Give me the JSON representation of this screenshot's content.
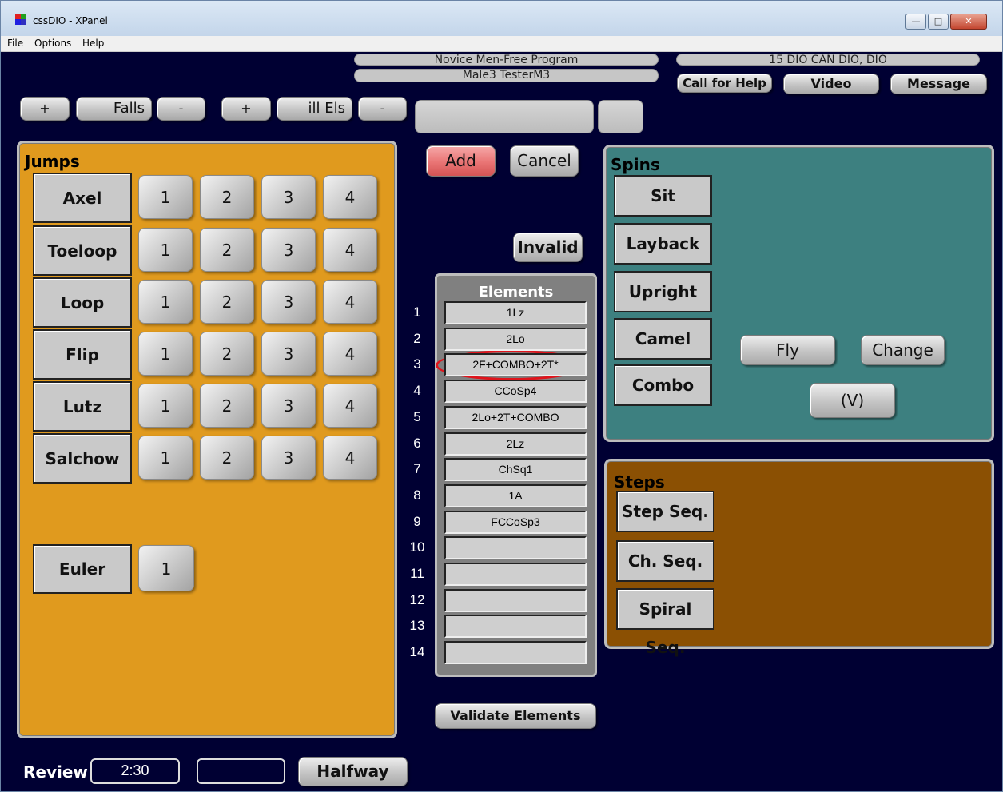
{
  "window": {
    "title": "cssDIO - XPanel"
  },
  "menu": [
    "File",
    "Options",
    "Help"
  ],
  "header": {
    "program": "Novice Men-Free Program",
    "skater": "Male3 TesterM3",
    "event": "15 DIO CAN DIO, DIO",
    "call_help": "Call for Help",
    "video": "Video",
    "message": "Message"
  },
  "counters": {
    "plus1": "+",
    "falls": "Falls",
    "minus1": "-",
    "plus2": "+",
    "ill_els": "ill Els",
    "minus2": "-"
  },
  "actions": {
    "add": "Add",
    "cancel": "Cancel",
    "invalid": "Invalid",
    "validate": "Validate Elements"
  },
  "jumps": {
    "title": "Jumps",
    "rows": [
      {
        "name": "Axel",
        "levels": [
          "1",
          "2",
          "3",
          "4"
        ]
      },
      {
        "name": "Toeloop",
        "levels": [
          "1",
          "2",
          "3",
          "4"
        ]
      },
      {
        "name": "Loop",
        "levels": [
          "1",
          "2",
          "3",
          "4"
        ]
      },
      {
        "name": "Flip",
        "levels": [
          "1",
          "2",
          "3",
          "4"
        ]
      },
      {
        "name": "Lutz",
        "levels": [
          "1",
          "2",
          "3",
          "4"
        ]
      },
      {
        "name": "Salchow",
        "levels": [
          "1",
          "2",
          "3",
          "4"
        ]
      }
    ],
    "euler": {
      "name": "Euler",
      "level": "1"
    }
  },
  "elements": {
    "title": "Elements",
    "numbers": [
      "1",
      "2",
      "3",
      "4",
      "5",
      "6",
      "7",
      "8",
      "9",
      "10",
      "11",
      "12",
      "13",
      "14"
    ],
    "items": [
      "1Lz",
      "2Lo",
      "2F+COMBO+2T*",
      "CCoSp4",
      "2Lo+2T+COMBO",
      "2Lz",
      "ChSq1",
      "1A",
      "FCCoSp3",
      "",
      "",
      "",
      "",
      ""
    ]
  },
  "spins": {
    "title": "Spins",
    "types": [
      "Sit",
      "Layback",
      "Upright",
      "Camel",
      "Combo"
    ],
    "fly": "Fly",
    "change": "Change",
    "v": "(V)"
  },
  "steps": {
    "title": "Steps",
    "types": [
      "Step Seq.",
      "Ch. Seq.",
      "Spiral Seq."
    ]
  },
  "footer": {
    "review": "Review",
    "time": "2:30",
    "blank": "",
    "halfway": "Halfway"
  },
  "colors": {
    "background": "#000033",
    "jumps_panel": "#e09a1e",
    "spins_panel": "#3d8080",
    "steps_panel": "#8b5003",
    "add_button": "#e97474",
    "highlight": "#e0141c"
  }
}
